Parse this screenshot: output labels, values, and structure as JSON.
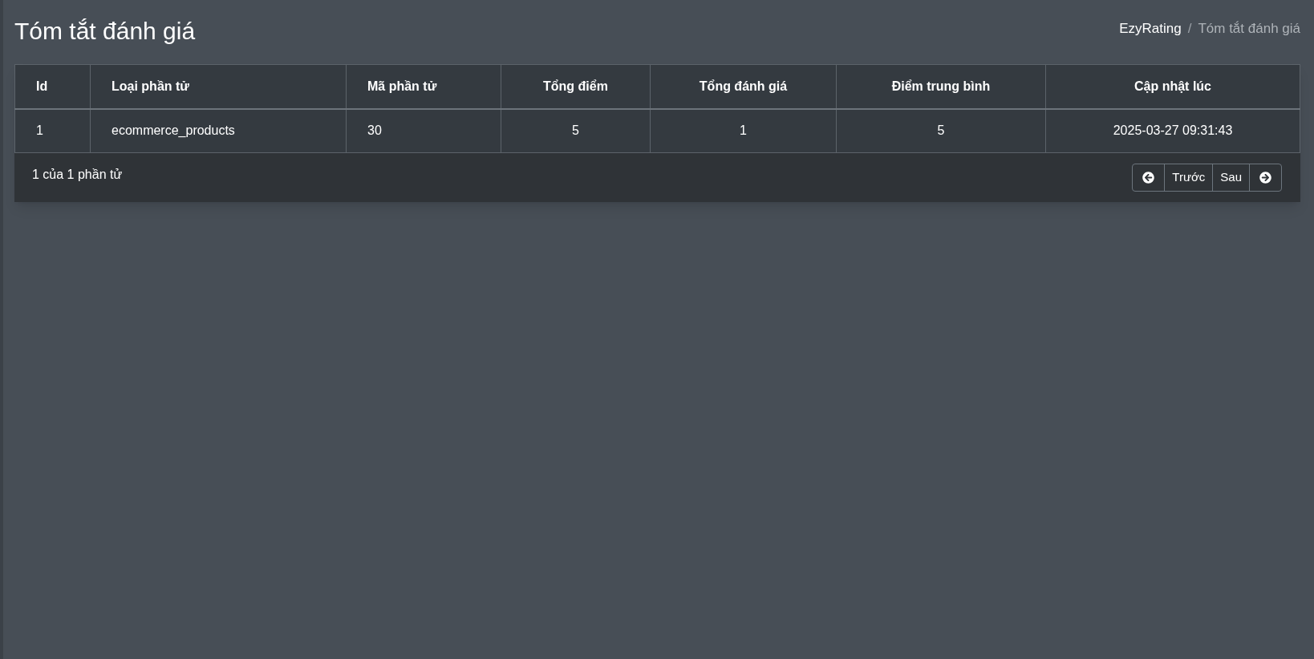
{
  "page_title": "Tóm tắt đánh giá",
  "breadcrumb_separator": "/",
  "breadcrumb": [
    {
      "label": "EzyRating",
      "selected": false
    },
    {
      "label": "Tóm tắt đánh giá",
      "selected": true
    }
  ],
  "table": {
    "columns": [
      "Id",
      "Loại phần tử",
      "Mã phần tử",
      "Tổng điểm",
      "Tổng đánh giá",
      "Điểm trung bình",
      "Cập nhật lúc"
    ],
    "rows": [
      [
        "1",
        "ecommerce_products",
        "30",
        "5",
        "1",
        "5",
        "2025-03-27 09:31:43"
      ]
    ]
  },
  "footer": {
    "summary": "1 của 1 phần tử",
    "pagination": [
      "Trước",
      "Sau"
    ]
  }
}
